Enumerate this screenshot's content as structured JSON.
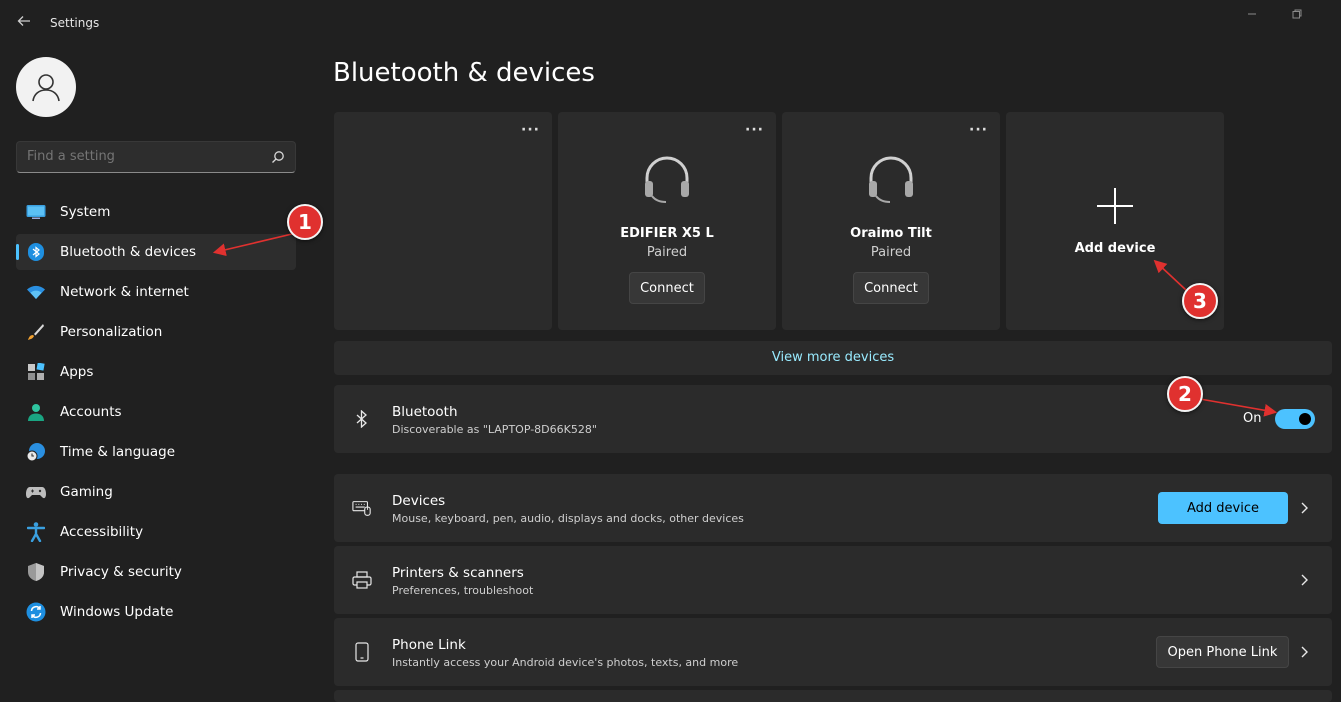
{
  "window": {
    "title": "Settings",
    "back_icon": "back-arrow-icon",
    "minimize_icon": "minimize-icon",
    "restore_icon": "restore-icon"
  },
  "sidebar": {
    "search_placeholder": "Find a setting",
    "items": [
      {
        "label": "System",
        "icon": "monitor-icon"
      },
      {
        "label": "Bluetooth & devices",
        "icon": "bluetooth-icon",
        "active": true
      },
      {
        "label": "Network & internet",
        "icon": "wifi-icon"
      },
      {
        "label": "Personalization",
        "icon": "brush-icon"
      },
      {
        "label": "Apps",
        "icon": "apps-icon"
      },
      {
        "label": "Accounts",
        "icon": "person-icon"
      },
      {
        "label": "Time & language",
        "icon": "globe-clock-icon"
      },
      {
        "label": "Gaming",
        "icon": "gamepad-icon"
      },
      {
        "label": "Accessibility",
        "icon": "accessibility-icon"
      },
      {
        "label": "Privacy & security",
        "icon": "shield-icon"
      },
      {
        "label": "Windows Update",
        "icon": "update-icon"
      }
    ]
  },
  "main": {
    "title": "Bluetooth & devices",
    "cards": [
      {
        "more": "···"
      },
      {
        "name": "EDIFIER X5 L",
        "status": "Paired",
        "button": "Connect",
        "more": "···"
      },
      {
        "name": "Oraimo Tilt",
        "status": "Paired",
        "button": "Connect",
        "more": "···"
      },
      {
        "add_label": "Add device"
      }
    ],
    "view_more": "View more devices",
    "bluetooth": {
      "title": "Bluetooth",
      "subtitle": "Discoverable as \"LAPTOP-8D66K528\"",
      "toggle_label": "On",
      "enabled": true
    },
    "rows": [
      {
        "title": "Devices",
        "subtitle": "Mouse, keyboard, pen, audio, displays and docks, other devices",
        "button": "Add device"
      },
      {
        "title": "Printers & scanners",
        "subtitle": "Preferences, troubleshoot"
      },
      {
        "title": "Phone Link",
        "subtitle": "Instantly access your Android device's photos, texts, and more",
        "button": "Open Phone Link"
      }
    ]
  },
  "annotations": {
    "one": "1",
    "two": "2",
    "three": "3"
  },
  "colors": {
    "accent": "#4cc2ff",
    "link": "#99ebff",
    "badge": "#e0312f",
    "background": "#202020",
    "card": "#2b2b2b"
  }
}
